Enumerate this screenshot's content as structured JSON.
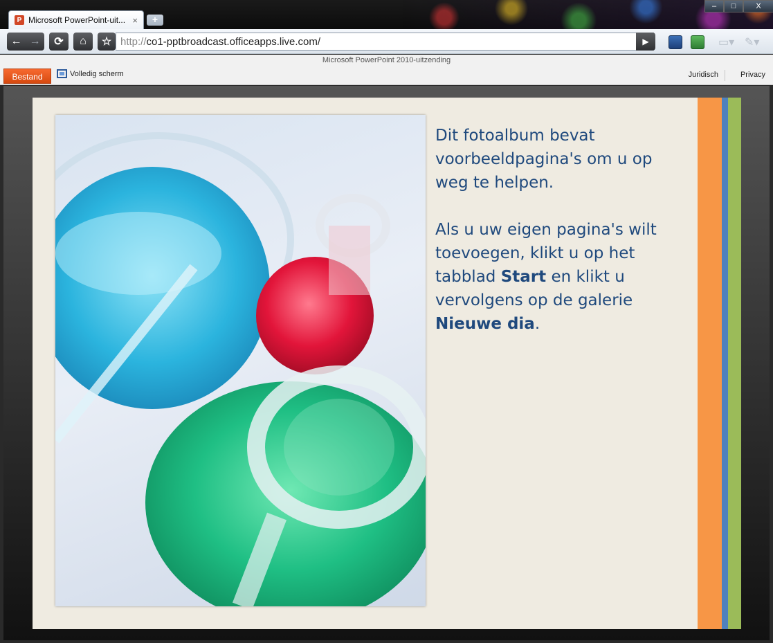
{
  "browser": {
    "tab_title": "Microsoft PowerPoint-uit...",
    "tab_favicon": "P",
    "tab_close": "×",
    "new_tab": "+",
    "url_scheme": "http://",
    "url_host": "co1-pptbroadcast.officeapps.live.com/",
    "window_controls": {
      "minimize": "‒",
      "maximize": "□",
      "close": "X"
    }
  },
  "app": {
    "title": "Microsoft PowerPoint 2010-uitzending",
    "file_menu": "Bestand",
    "fullscreen_label": "Volledig scherm",
    "legal_link": "Juridisch",
    "privacy_link": "Privacy"
  },
  "slide": {
    "paragraph1": "Dit fotoalbum bevat voorbeeldpagina's om u op weg te helpen.",
    "p2_part1": "Als u uw eigen pagina's wilt toevoegen, klikt u op het tabblad ",
    "p2_bold1": "Start",
    "p2_part2": " en klikt u vervolgens op de galerie ",
    "p2_bold2": "Nieuwe dia",
    "p2_part3": ".",
    "accent_colors": [
      "#f79646",
      "#4f81bd",
      "#9bbb59"
    ],
    "text_color": "#1f497d"
  },
  "icons": {
    "back": "back-arrow-icon",
    "forward": "forward-arrow-icon",
    "reload": "reload-icon",
    "home": "home-icon",
    "bookmark": "star-icon",
    "go": "play-icon"
  }
}
